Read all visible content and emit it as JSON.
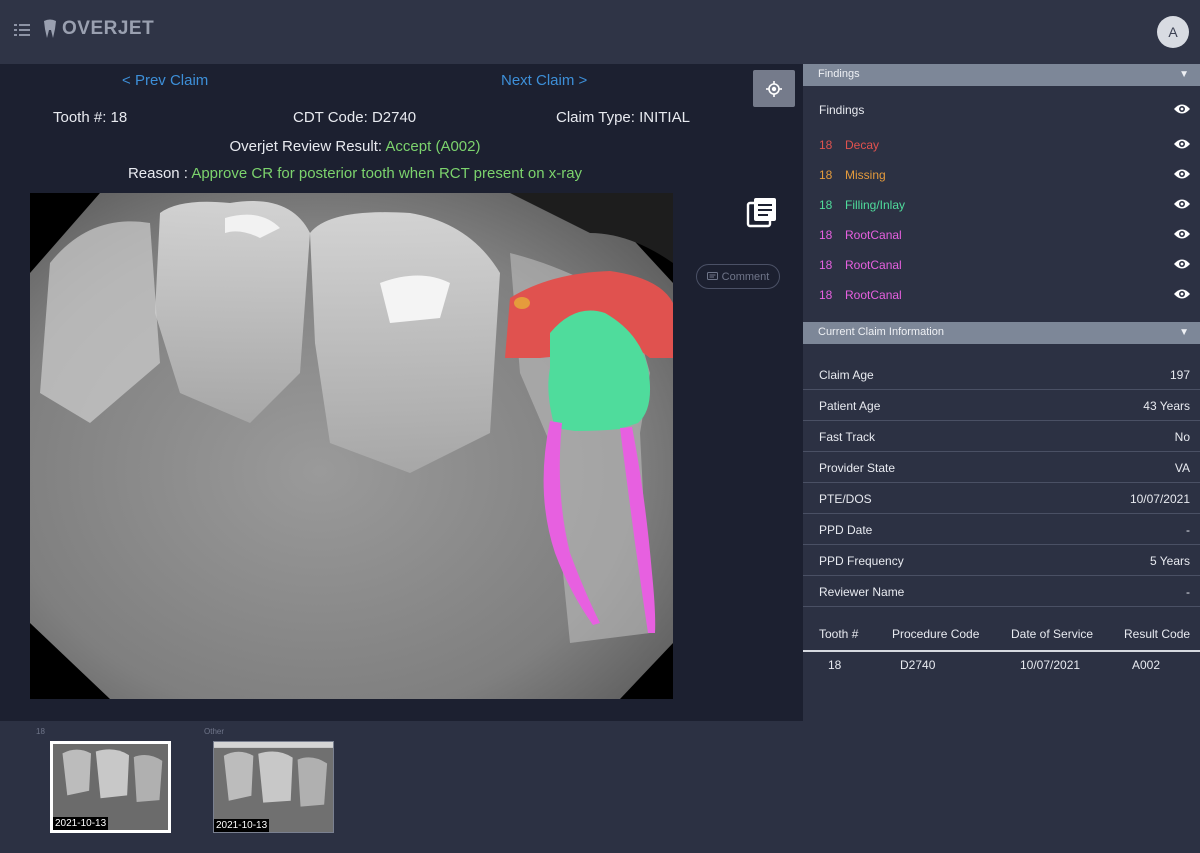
{
  "app": {
    "name": "OVERJET",
    "avatar_initial": "A"
  },
  "nav": {
    "prev": "Prev Claim",
    "next": "Next Claim"
  },
  "claim": {
    "tooth_label": "Tooth #:",
    "tooth_value": "18",
    "cdt_label": "CDT Code:",
    "cdt_value": "D2740",
    "type_label": "Claim Type:",
    "type_value": "INITIAL",
    "review_label": "Overjet Review Result:",
    "review_value": "Accept (A002)",
    "reason_label": "Reason :",
    "reason_value": "Approve CR for posterior tooth when RCT present on x-ray"
  },
  "comment_label": "Comment",
  "thumbnails": [
    {
      "group": "18",
      "date": "2021-10-13"
    },
    {
      "group": "Other",
      "date": "2021-10-13"
    }
  ],
  "findings": {
    "header": "Findings",
    "title": "Findings",
    "items": [
      {
        "tooth": "18",
        "label": "Decay",
        "color": "#e0524f"
      },
      {
        "tooth": "18",
        "label": "Missing",
        "color": "#e59b3c"
      },
      {
        "tooth": "18",
        "label": "Filling/Inlay",
        "color": "#4fdc9c"
      },
      {
        "tooth": "18",
        "label": "RootCanal",
        "color": "#e760e0"
      },
      {
        "tooth": "18",
        "label": "RootCanal",
        "color": "#e760e0"
      },
      {
        "tooth": "18",
        "label": "RootCanal",
        "color": "#e760e0"
      }
    ]
  },
  "claim_info": {
    "header": "Current Claim Information",
    "rows": [
      {
        "key": "Claim Age",
        "value": "197"
      },
      {
        "key": "Patient Age",
        "value": "43 Years"
      },
      {
        "key": "Fast Track",
        "value": "No"
      },
      {
        "key": "Provider State",
        "value": "VA"
      },
      {
        "key": "PTE/DOS",
        "value": "10/07/2021"
      },
      {
        "key": "PPD Date",
        "value": "-"
      },
      {
        "key": "PPD Frequency",
        "value": "5 Years"
      },
      {
        "key": "Reviewer Name",
        "value": "-"
      }
    ]
  },
  "procedures": {
    "headers": [
      "Tooth #",
      "Procedure Code",
      "Date of Service",
      "Result Code"
    ],
    "rows": [
      [
        "18",
        "D2740",
        "10/07/2021",
        "A002"
      ]
    ]
  },
  "colors": {
    "link": "#3d8fd8",
    "accept": "#7cd36d",
    "decay": "#e0524f",
    "missing": "#e59b3c",
    "filling": "#4fdc9c",
    "rootcanal": "#e760e0"
  }
}
